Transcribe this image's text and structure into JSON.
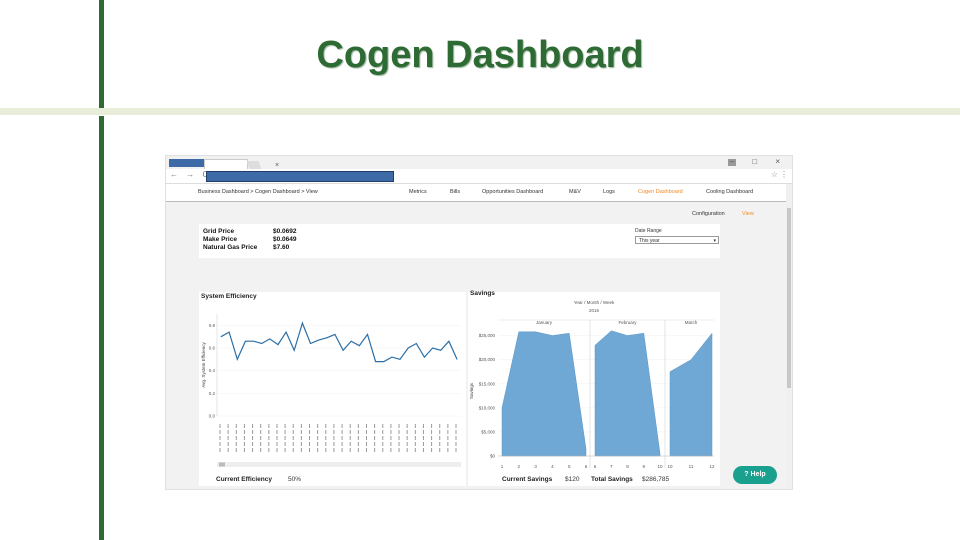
{
  "slide": {
    "title": "Cogen Dashboard"
  },
  "browser": {
    "nav_arrows": "← → C",
    "tab_close": "×",
    "window_controls": "– □ ×",
    "star": "☆",
    "menu": "⋮"
  },
  "app": {
    "breadcrumb": "Business Dashboard > Cogen Dashboard > View",
    "nav": [
      "Metrics",
      "Bills",
      "Opportunities Dashboard",
      "M&V",
      "Logs",
      "Cogen Dashboard",
      "Cooling Dashboard"
    ],
    "active_nav": "Cogen Dashboard",
    "subnav": {
      "configuration": "Configuration",
      "view": "View"
    },
    "accent": "#f08a2a"
  },
  "prices": {
    "grid_price_label": "Grid Price",
    "grid_price_value": "$0.0692",
    "make_price_label": "Make Price",
    "make_price_value": "$0.0649",
    "gas_price_label": "Natural Gas Price",
    "gas_price_value": "$7.60"
  },
  "date_range": {
    "label": "Date Range",
    "selected": "This year"
  },
  "efficiency": {
    "title": "System Efficiency",
    "ylabel": "Avg. System Efficiency",
    "current_label": "Current Efficiency",
    "current_value": "50%"
  },
  "savings": {
    "title": "Savings",
    "drill": "Year / Month / Week",
    "year": "2016",
    "ylabel": "Savings",
    "current_label": "Current Savings",
    "current_value": "$120",
    "total_label": "Total Savings",
    "total_value": "$286,785"
  },
  "help": {
    "label": "? Help"
  },
  "chart_data": [
    {
      "type": "line",
      "title": "System Efficiency",
      "ylabel": "Avg. System Efficiency",
      "ylim": [
        0,
        0.9
      ],
      "yticks": [
        "0.0",
        "0.2",
        "0.4",
        "0.6",
        "0.8"
      ],
      "values": [
        0.7,
        0.74,
        0.5,
        0.66,
        0.66,
        0.64,
        0.68,
        0.63,
        0.74,
        0.58,
        0.82,
        0.64,
        0.67,
        0.69,
        0.72,
        0.58,
        0.66,
        0.62,
        0.72,
        0.48,
        0.48,
        0.52,
        0.5,
        0.6,
        0.64,
        0.52,
        0.6,
        0.58,
        0.66,
        0.5
      ]
    },
    {
      "type": "area",
      "title": "Savings",
      "ylabel": "Savings",
      "ylim": [
        0,
        27000
      ],
      "yticks": [
        "$0",
        "$5,000",
        "$10,000",
        "$15,000",
        "$20,000",
        "$25,000"
      ],
      "panels": [
        {
          "name": "January",
          "x": [
            "1",
            "2",
            "3",
            "4",
            "5",
            "6"
          ],
          "values": [
            10000,
            25800,
            25800,
            25000,
            25500,
            1500
          ]
        },
        {
          "name": "February",
          "x": [
            "6",
            "7",
            "8",
            "9",
            "10"
          ],
          "values": [
            23000,
            26000,
            25000,
            25500,
            500
          ]
        },
        {
          "name": "March",
          "x": [
            "10",
            "11",
            "12"
          ],
          "values": [
            17500,
            20000,
            25500
          ]
        }
      ]
    }
  ]
}
